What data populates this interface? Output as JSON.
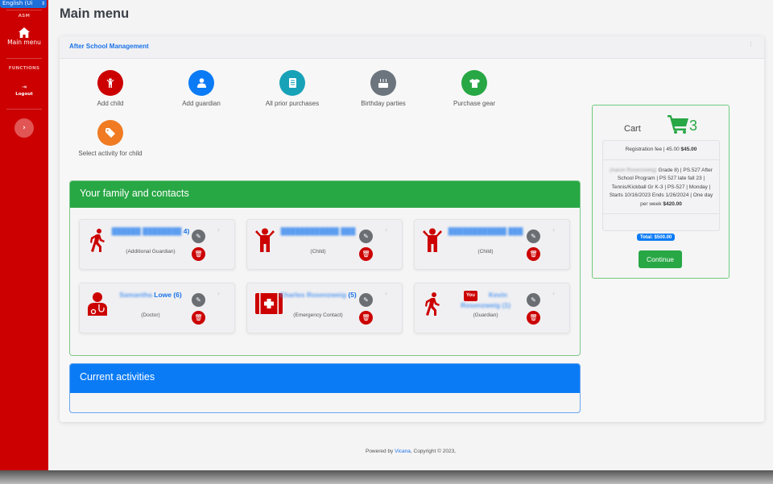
{
  "sidebar": {
    "language": "English (Ui",
    "section_app": "ASM",
    "home_label": "Main menu",
    "section_functions": "FUNCTIONS",
    "logout_label": "Logout",
    "expand_icon": "chevron-right"
  },
  "page": {
    "title": "Main menu"
  },
  "card": {
    "title": "After School Management"
  },
  "actions": [
    {
      "label": "Add child",
      "icon": "child-icon",
      "color": "#cc0000"
    },
    {
      "label": "Add guardian",
      "icon": "user-icon",
      "color": "#0b7bf5"
    },
    {
      "label": "All prior purchases",
      "icon": "receipt-icon",
      "color": "#17a2b8"
    },
    {
      "label": "Birthday parties",
      "icon": "cake-icon",
      "color": "#6c757d"
    },
    {
      "label": "Purchase gear",
      "icon": "tshirt-icon",
      "color": "#28a745"
    },
    {
      "label": "Select activity for child",
      "icon": "tag-icon",
      "color": "#f07b22"
    }
  ],
  "family": {
    "title": "Your family and contacts",
    "contacts": [
      {
        "name_blurred": "██████ ████████",
        "name_suffix": "4)",
        "role": "(Additional Guardian)",
        "icon": "walking-person-icon"
      },
      {
        "name_blurred": "████████████ ███",
        "name_suffix": "",
        "role": "(Child)",
        "icon": "child-icon"
      },
      {
        "name_blurred": "████████████ ███",
        "name_suffix": "",
        "role": "(Child)",
        "icon": "child-icon"
      },
      {
        "name_blurred": "Samantha",
        "name_suffix": "Lowe (6)",
        "role": "(Doctor)",
        "icon": "doctor-icon"
      },
      {
        "name_blurred": "Charles Rosenzweig",
        "name_suffix": "(5)",
        "role": "(Emergency Contact)",
        "icon": "first-aid-icon"
      },
      {
        "name_blurred": "Kevin Rosenzweig (1)",
        "name_suffix": "",
        "role": "(Guardian)",
        "icon": "walking-person-icon",
        "badge": "You"
      }
    ]
  },
  "activities": {
    "title": "Current activities"
  },
  "cart": {
    "title": "Cart",
    "count": "3",
    "items": [
      {
        "text": "Registration fee | 45.00",
        "price": "$45.00"
      },
      {
        "blurred": "(Aaron Rosenzweig",
        "text": ": Grade 8) | PS.527 After School Program | PS 527 late fall 23 | Tennis/Kickball Gr K-3 | PS-527 | Monday | Starts 10/16/2023 Ends 1/26/2024 | One day per week",
        "price": "$420.00"
      }
    ],
    "total": "Total: $500.00",
    "continue_label": "Continue"
  },
  "footer": {
    "prefix": "Powered by ",
    "link": "Vicana",
    "suffix": ", Copyright © 2023,"
  },
  "colors": {
    "brand_red": "#cc0000",
    "success_green": "#28a745",
    "primary_blue": "#0b7bf5"
  }
}
